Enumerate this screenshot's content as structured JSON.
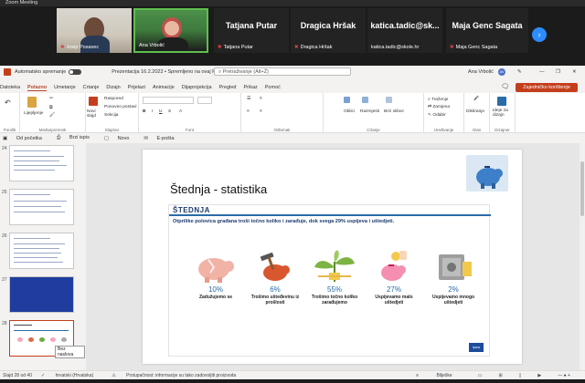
{
  "zoom": {
    "window_title": "Zoom Meeting",
    "participants": [
      {
        "name": "Josip Posavec",
        "muted": true,
        "video": true
      },
      {
        "name": "Ana Vrbolić",
        "muted": false,
        "video": true
      },
      {
        "name": "Tatjana Putar",
        "display": "Tatjana Putar",
        "muted": true
      },
      {
        "name": "Dragica Hršak",
        "display": "Dragica Hršak",
        "muted": true
      },
      {
        "name": "katica.tadic@skole.hr",
        "display": "katica.tadic@sk...",
        "muted": false
      },
      {
        "name": "Maja Genc Sagata",
        "display": "Maja Genc Sagata",
        "muted": true
      }
    ],
    "next_icon": "chevron-right-icon"
  },
  "ppt": {
    "autosave_label": "Automatsko spremanje",
    "file_title": "Prezentacija 16.2.2022 • Spremljeno na ovaj PC",
    "search_placeholder": "Pretraživanje (Alt+Ž)",
    "user_name": "Ana Vrbolić",
    "user_initials": "AV",
    "menu": [
      "Datoteka",
      "Polazno",
      "Umetanje",
      "Crtanje",
      "Dizajn",
      "Prijelazi",
      "Animacije",
      "Dijaprojekcija",
      "Pregled",
      "Prikaz",
      "Pomoć"
    ],
    "active_menu": "Polazno",
    "collab_button": "Zajedničko korištenje",
    "ribbon": {
      "groups": [
        "Poništi",
        "Međuspremnik",
        "Slajdovi",
        "Font",
        "Odlomak",
        "Crtanje",
        "Uređivanje",
        "Glas",
        "Dizajner"
      ],
      "buttons": {
        "paste": "Lijepljenje",
        "new_slide": "Novi slajd",
        "layout": "Raspored",
        "reset": "Ponovno postavi",
        "section": "Sekcija",
        "shapes": "Oblici",
        "arrange": "Razmjesti",
        "quick_styles": "Brzi stilovi",
        "find": "Traženje",
        "replace": "Zamjena",
        "select": "Odabir",
        "dictate": "Diktiranje",
        "designer": "Ideje za dizajn"
      }
    },
    "qat": [
      "Od početka",
      "Brzi ispis",
      "Novo",
      "E-pošta"
    ],
    "thumbnails": [
      {
        "num": "24",
        "selected": false,
        "style": "text"
      },
      {
        "num": "25",
        "selected": false,
        "style": "text"
      },
      {
        "num": "26",
        "selected": false,
        "style": "text"
      },
      {
        "num": "27",
        "selected": false,
        "style": "blue"
      },
      {
        "num": "28",
        "selected": true,
        "style": "infographic"
      }
    ],
    "thumb_tooltip": "Bez naslova",
    "slide": {
      "title": "Štednja - statistika",
      "inner_title": "ŠTEDNJA",
      "subtitle": "Otprilike polovica građana troši točno koliko i zarađuje, dok svega 29% uspijeva i uštedjeti.",
      "items": [
        {
          "pct": "10%",
          "label": "Zadužujemo se",
          "icon": "broken-piggy-icon"
        },
        {
          "pct": "6%",
          "label": "Trošimo ušteđevinu iz prošlosti",
          "icon": "hammer-piggy-icon"
        },
        {
          "pct": "55%",
          "label": "Trošimo točno koliko zarađujemo",
          "icon": "money-plant-icon"
        },
        {
          "pct": "27%",
          "label": "Uspijevamo malo uštedjeti",
          "icon": "piggy-coin-icon"
        },
        {
          "pct": "2%",
          "label": "Uspijevamo mnogo uštedjeti",
          "icon": "safe-icon"
        }
      ],
      "logo": "Ipsos"
    },
    "status": {
      "slide_counter": "Slajd 28 od 40",
      "language": "hrvatski (Hrvatska)",
      "notice": "Prstupačnost: informacije su tako zadovoljiti proizvoda",
      "notes": "Bilješke"
    },
    "colors": {
      "accent": "#c43e1c",
      "slide_blue": "#2a6ba8",
      "dark_navy": "#1d3a6e"
    }
  }
}
